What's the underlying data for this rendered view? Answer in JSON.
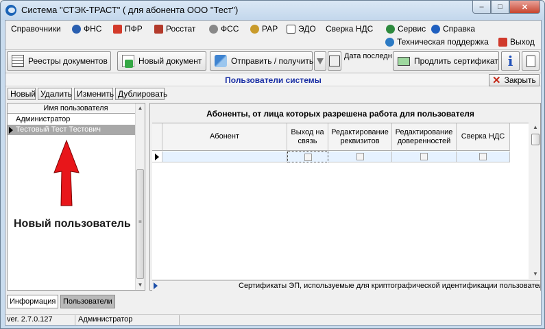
{
  "window": {
    "title": "Система \"СТЭК-ТРАСТ\" ( для абонента ООО \"Тест\")",
    "minimize_glyph": "–",
    "maximize_glyph": "□",
    "close_glyph": "✕"
  },
  "menu": {
    "items": [
      {
        "label": "Справочники",
        "icon": "none"
      },
      {
        "label": "ФНС",
        "icon": "fns-emblem-icon",
        "color": "#2a5fb0"
      },
      {
        "label": "ПФР",
        "icon": "pfr-logo-icon",
        "color": "#d33a2a"
      },
      {
        "label": "Росстат",
        "icon": "rosstat-logo-icon",
        "color": "#b33a2b"
      },
      {
        "label": "ФСС",
        "icon": "fss-logo-icon",
        "color": "#777777"
      },
      {
        "label": "РАР",
        "icon": "rar-emblem-icon",
        "color": "#c99b2b"
      },
      {
        "label": "ЭДО",
        "icon": "edo-icon",
        "color": "#444444"
      },
      {
        "label": "Сверка НДС",
        "icon": "none"
      },
      {
        "label": "Сервис",
        "icon": "service-gear-icon",
        "color": "#2e8a3e"
      },
      {
        "label": "Справка",
        "icon": "help-icon",
        "color": "#1f5fbf"
      }
    ],
    "row2": [
      {
        "label": "Техническая поддержка",
        "icon": "globe-icon",
        "color": "#2d7bc4"
      },
      {
        "label": "Выход",
        "icon": "exit-icon",
        "color": "#d0392b"
      }
    ]
  },
  "toolbar": {
    "registries": "Реестры документов",
    "new_document": "Новый документ",
    "send_receive": "Отправить / получить",
    "last_date_label": "Дата последн",
    "renew_certificate": "Продлить сертификат",
    "info_glyph": "i"
  },
  "panel": {
    "title": "Пользователи системы",
    "close": "Закрыть"
  },
  "actions": {
    "new": "Новый",
    "delete": "Удалить",
    "edit": "Изменить",
    "duplicate": "Дублировать"
  },
  "users": {
    "column": "Имя пользователя",
    "rows": [
      {
        "name": "Администратор",
        "selected": false
      },
      {
        "name": "Тестовый Тест Тестович",
        "selected": true
      }
    ]
  },
  "subscribers": {
    "title": "Абоненты, от лица которых разрешена работа для пользователя",
    "columns": [
      "Абонент",
      "Выход на связь",
      "Редактирование реквизитов",
      "Редактирование доверенностей",
      "Сверка НДС"
    ],
    "rows": [
      {
        "subscriber": "",
        "online": false,
        "edit_requisites": false,
        "edit_powers": false,
        "vat_reconciliation": false
      }
    ],
    "certificates_bar": "Сертификаты ЭП, используемые для криптографической идентификации пользователя"
  },
  "tabs": [
    {
      "label": "Информация",
      "active": true
    },
    {
      "label": "Пользователи",
      "active": false
    }
  ],
  "status": {
    "version": "ver. 2.7.0.127",
    "user": "Администратор"
  },
  "annotation": {
    "text": "Новый пользователь",
    "arrow_color": "#e8161a"
  }
}
